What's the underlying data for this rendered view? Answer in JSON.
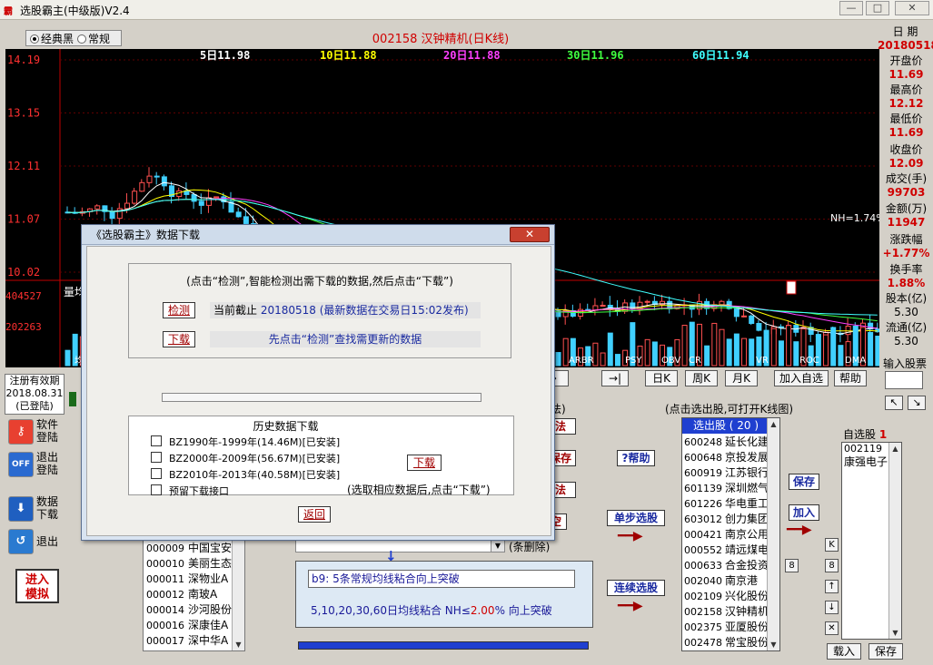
{
  "window": {
    "title": "选股霸主(中级版)V2.4",
    "min": "—",
    "max": "□",
    "close": "✕"
  },
  "theme": {
    "opt1": "经典黑",
    "opt2": "常规"
  },
  "stock": {
    "header": "002158  汉钟精机(日K线)"
  },
  "date": {
    "label": "日 期",
    "value": "20180518"
  },
  "chart": {
    "ma_labels": [
      {
        "text": "5日11.98",
        "color": "#ffffff"
      },
      {
        "text": "10日11.88",
        "color": "#ffff00"
      },
      {
        "text": "20日11.88",
        "color": "#ff40ff"
      },
      {
        "text": "30日11.96",
        "color": "#40ff40"
      },
      {
        "text": "60日11.94",
        "color": "#40ffff"
      }
    ],
    "price_ticks": [
      "14.19",
      "13.15",
      "12.11",
      "11.07",
      "10.02"
    ],
    "volume_ticks": [
      "404527",
      "202263"
    ],
    "volume_label": "量均",
    "indicator_tabs": [
      "ARBR",
      "PSY",
      "OBV",
      "CR",
      "VR",
      "ROC",
      "DMA"
    ],
    "nh_label": "NH=1.74%",
    "indicator_left": "均"
  },
  "info": [
    {
      "label": "开盘价",
      "value": "11.69"
    },
    {
      "label": "最高价",
      "value": "12.12"
    },
    {
      "label": "最低价",
      "value": "11.69"
    },
    {
      "label": "收盘价",
      "value": "12.09"
    },
    {
      "label": "成交(手)",
      "value": "99703"
    },
    {
      "label": "金额(万)",
      "value": "11947"
    },
    {
      "label": "涨跌幅",
      "value": "+1.77%"
    },
    {
      "label": "换手率",
      "value": "1.88%"
    },
    {
      "label": "股本(亿)",
      "value": "5.30"
    },
    {
      "label": "流通(亿)",
      "value": "5.30"
    }
  ],
  "input": {
    "label": "输入股票",
    "up": "↖",
    "down": "↘"
  },
  "toolbar": {
    "nav1": "··→",
    "nav2": "→|",
    "day": "日K",
    "week": "周K",
    "month": "月K",
    "add_fav": "加入自选",
    "help": "帮助"
  },
  "reg": {
    "line1": "注册有效期",
    "line2": "2018.08.31",
    "line3": "(已登陆)"
  },
  "side": {
    "login1": "软件",
    "login2": "登陆",
    "logout1": "退出",
    "logout2": "登陆",
    "dl1": "数据",
    "dl2": "下载",
    "exit": "退出",
    "sim1": "进入",
    "sim2": "模拟"
  },
  "left_list": [
    {
      "code": "000009",
      "name": "中国宝安"
    },
    {
      "code": "000010",
      "name": "美丽生态"
    },
    {
      "code": "000011",
      "name": "深物业A"
    },
    {
      "code": "000012",
      "name": "南玻A"
    },
    {
      "code": "000014",
      "name": "沙河股份"
    },
    {
      "code": "000016",
      "name": "深康佳A"
    },
    {
      "code": "000017",
      "name": "深中华A"
    }
  ],
  "cond": {
    "delete_note": "(条删除)",
    "formula_name": "b9: 5条常规均线粘合向上突破",
    "formula_desc_a": "5,10,20,30,60日均线粘合  NH≤",
    "formula_value": "2.00",
    "formula_desc_b": "%   向上突破"
  },
  "mid_buttons": {
    "fa1": "法",
    "save": "保存",
    "fa2": "法",
    "empty": "空",
    "help": "?帮助",
    "step": "单步选股",
    "cont": "连续选股",
    "la": "法)"
  },
  "select": {
    "hint": "(点击选出股,可打开K线图)",
    "header": "选出股 (  20  )",
    "rows": [
      {
        "code": "600248",
        "name": "延长化建"
      },
      {
        "code": "600648",
        "name": "京投发展"
      },
      {
        "code": "600919",
        "name": "江苏银行"
      },
      {
        "code": "601139",
        "name": "深圳燃气"
      },
      {
        "code": "601226",
        "name": "华电重工"
      },
      {
        "code": "603012",
        "name": "创力集团"
      },
      {
        "code": "000421",
        "name": "南京公用"
      },
      {
        "code": "000552",
        "name": "靖远煤电"
      },
      {
        "code": "000633",
        "name": "合金投资"
      },
      {
        "code": "002040",
        "name": "南京港"
      },
      {
        "code": "002109",
        "name": "兴化股份"
      },
      {
        "code": "002158",
        "name": "汉钟精机"
      },
      {
        "code": "002375",
        "name": "亚厦股份"
      },
      {
        "code": "002478",
        "name": "常宝股份"
      }
    ]
  },
  "mystock": {
    "title": "自选股",
    "count": "1",
    "rows": [
      {
        "code": "002119",
        "name": "康强电子"
      }
    ],
    "save": "保存",
    "add": "加入",
    "load": "载入",
    "save2": "保存",
    "k": "K",
    "eight": "8",
    "up": "↑",
    "down": "↓",
    "del": "✕",
    "mid8": "8"
  },
  "dialog": {
    "title": "《选股霸主》数据下载",
    "close": "✕",
    "instruction": "(点击“检测”,智能检测出需下载的数据,然后点击“下载”)",
    "check_btn": "检测",
    "status_label": "当前截止",
    "status_date": "20180518",
    "status_note": "(最新数据在交易日15:02发布)",
    "download_btn": "下载",
    "download_hint": "先点击“检测”查找需更新的数据",
    "history_title": "历史数据下载",
    "history": [
      {
        "label": "BZ1990年-1999年(14.46M)[已安装]"
      },
      {
        "label": "BZ2000年-2009年(56.67M)[已安装]"
      },
      {
        "label": "BZ2010年-2013年(40.58M)[已安装]"
      },
      {
        "label": "预留下载接口"
      }
    ],
    "history_download": "下载",
    "history_note": "(选取相应数据后,点击“下载”)",
    "back": "返回"
  }
}
